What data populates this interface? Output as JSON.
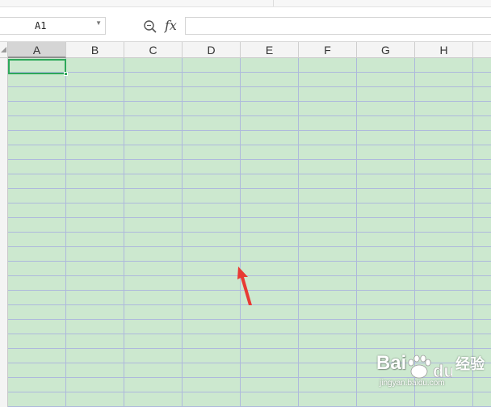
{
  "formula_bar": {
    "name_box_value": "A1",
    "fx_label": "fx",
    "formula_value": ""
  },
  "columns": [
    "A",
    "B",
    "C",
    "D",
    "E",
    "F",
    "G",
    "H"
  ],
  "active_cell": "A1",
  "sheet": {
    "cell_fill_color": "#cce8cf",
    "gridline_color": "#aeb9dc",
    "selection_color": "#2ea85a"
  },
  "annotation": {
    "arrow_color": "#e83a34"
  },
  "watermark": {
    "brand": "Bai",
    "brand_tail": "",
    "sub": "经验",
    "url": "jingyan.baidu.com"
  },
  "icons": {
    "zoom": "zoom-magnifier-icon",
    "dropdown": "chevron-down-icon",
    "corner": "select-all-triangle-icon"
  }
}
